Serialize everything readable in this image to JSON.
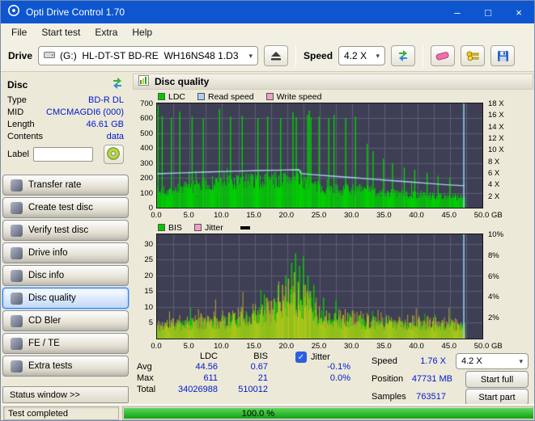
{
  "window": {
    "title": "Opti Drive Control 1.70",
    "controls": {
      "minimize": "–",
      "maximize": "□",
      "close": "×"
    }
  },
  "menu": [
    "File",
    "Start test",
    "Extra",
    "Help"
  ],
  "toolbar": {
    "drive_label": "Drive",
    "drive_value": "(G:)  HL-DT-ST BD-RE  WH16NS48 1.D3",
    "speed_label": "Speed",
    "speed_value": "4.2 X"
  },
  "sidebar": {
    "header": "Disc",
    "info": [
      {
        "label": "Type",
        "value": "BD-R DL"
      },
      {
        "label": "MID",
        "value": "CMCMAGDI6 (000)"
      },
      {
        "label": "Length",
        "value": "46.61 GB"
      },
      {
        "label": "Contents",
        "value": "data"
      }
    ],
    "label_field": {
      "label": "Label",
      "value": ""
    },
    "nav": [
      "Transfer rate",
      "Create test disc",
      "Verify test disc",
      "Drive info",
      "Disc info",
      "Disc quality",
      "CD Bler",
      "FE / TE",
      "Extra tests"
    ],
    "active_nav": "Disc quality",
    "status_window": "Status window >>"
  },
  "main": {
    "title": "Disc quality"
  },
  "stats": {
    "col_ldc": "LDC",
    "col_bis": "BIS",
    "rows": [
      {
        "label": "Avg",
        "ldc": "44.56",
        "bis": "0.67"
      },
      {
        "label": "Max",
        "ldc": "611",
        "bis": "21"
      },
      {
        "label": "Total",
        "ldc": "34026988",
        "bis": "510012"
      }
    ],
    "jitter": {
      "label": "Jitter",
      "checked": true,
      "check_glyph": "✓",
      "avg": "-0.1%",
      "max": "0.0%"
    },
    "speed": {
      "label": "Speed",
      "value": "1.76 X",
      "select": "4.2 X"
    },
    "position": {
      "label": "Position",
      "value": "47731 MB"
    },
    "samples": {
      "label": "Samples",
      "value": "763517"
    },
    "start_full": "Start full",
    "start_part": "Start part"
  },
  "statusbar": {
    "text": "Test completed",
    "progress": "100.0 %"
  },
  "colors": {
    "titlebar_blue": "#0d56d0",
    "value_blue": "#0018cc",
    "chart_bg": "#3e3e54",
    "ldc_green": "#00c800",
    "read_speed_blue": "#a8d0f0",
    "write_speed_pink": "#f0a0c8",
    "jitter_yellow": "#d2c422",
    "progress_green": "#2db82d"
  },
  "chart_data": [
    {
      "name": "ldc",
      "type": "area",
      "title": "Disc quality - LDC / Read speed / Write speed",
      "legend": [
        {
          "label": "LDC",
          "color": "#00c800"
        },
        {
          "label": "Read speed",
          "color": "#a8d0f0"
        },
        {
          "label": "Write speed",
          "color": "#f0a0c8"
        }
      ],
      "marker_dash": false,
      "bg": "#3e3e54",
      "grid": "#5d5d79",
      "xmax": 50,
      "ymax": 700,
      "data_end": 47.3,
      "xgrid": 2.5,
      "cursor": {
        "x": 47.15,
        "color": "#8ad4ee"
      },
      "hlines": [
        0.1429,
        0.2857,
        0.4286,
        0.5714,
        0.7143,
        0.8571
      ],
      "ticks_left": [
        {
          "t": "700",
          "f": 0
        },
        {
          "t": "600",
          "f": 0.1429
        },
        {
          "t": "500",
          "f": 0.2857
        },
        {
          "t": "400",
          "f": 0.4286
        },
        {
          "t": "300",
          "f": 0.5714
        },
        {
          "t": "200",
          "f": 0.7143
        },
        {
          "t": "100",
          "f": 0.8571
        },
        {
          "t": "0",
          "f": 1
        }
      ],
      "ticks_right": [
        {
          "t": "18 X",
          "f": 0
        },
        {
          "t": "16 X",
          "f": 0.111
        },
        {
          "t": "14 X",
          "f": 0.222
        },
        {
          "t": "12 X",
          "f": 0.333
        },
        {
          "t": "10 X",
          "f": 0.444
        },
        {
          "t": "8 X",
          "f": 0.556
        },
        {
          "t": "6 X",
          "f": 0.667
        },
        {
          "t": "4 X",
          "f": 0.778
        },
        {
          "t": "2 X",
          "f": 0.889
        }
      ],
      "ticks_x": [
        {
          "t": "0.0",
          "f": 0
        },
        {
          "t": "5.0",
          "f": 0.1
        },
        {
          "t": "10.0",
          "f": 0.2
        },
        {
          "t": "15.0",
          "f": 0.3
        },
        {
          "t": "20.0",
          "f": 0.4
        },
        {
          "t": "25.0",
          "f": 0.5
        },
        {
          "t": "30.0",
          "f": 0.6
        },
        {
          "t": "35.0",
          "f": 0.7
        },
        {
          "t": "40.0",
          "f": 0.8
        },
        {
          "t": "45.0",
          "f": 0.9
        },
        {
          "t": "50.0",
          "f": 1
        }
      ],
      "x_unit": "GB",
      "series": [
        {
          "name": "LDC",
          "color": "#00d400",
          "seed": 7,
          "step": 0.12,
          "base": 0.55,
          "var": 0.55,
          "min": 10,
          "envelope": [
            [
              0,
              125
            ],
            [
              3,
              150
            ],
            [
              6,
              175
            ],
            [
              10,
              205
            ],
            [
              14,
              215
            ],
            [
              18,
              228
            ],
            [
              21.5,
              238
            ],
            [
              23,
              225
            ],
            [
              24,
              185
            ],
            [
              25,
              155
            ],
            [
              28,
              150
            ],
            [
              31,
              148
            ],
            [
              34,
              128
            ],
            [
              38,
              112
            ],
            [
              42,
              100
            ],
            [
              45,
              90
            ],
            [
              47.3,
              84
            ]
          ],
          "spikes": [
            [
              0.15,
              688
            ],
            [
              0.8,
              615
            ],
            [
              2.2,
              605
            ],
            [
              3.5,
              645
            ],
            [
              5.4,
              612
            ],
            [
              7.1,
              598
            ],
            [
              9.6,
              662
            ],
            [
              11.3,
              612
            ],
            [
              13.1,
              618
            ],
            [
              15.5,
              602
            ],
            [
              17,
              612
            ],
            [
              19,
              602
            ],
            [
              20.9,
              642
            ],
            [
              21.4,
              608
            ],
            [
              23.15,
              622
            ],
            [
              23.4,
              652
            ],
            [
              23.65,
              608
            ],
            [
              24.9,
              612
            ],
            [
              26.4,
              602
            ],
            [
              27.2,
              622
            ],
            [
              29,
              602
            ],
            [
              30.5,
              612
            ],
            [
              32.3,
              430
            ],
            [
              33.2,
              380
            ],
            [
              34.8,
              330
            ],
            [
              36.2,
              300
            ],
            [
              38,
              270
            ],
            [
              39.6,
              255
            ],
            [
              41.5,
              235
            ],
            [
              43.2,
              215
            ],
            [
              45,
              200
            ]
          ]
        }
      ],
      "lines": [
        {
          "name": "Read speed",
          "color": "#a8d0f0",
          "width": 1.4,
          "points": [
            [
              0,
              228
            ],
            [
              4,
              234
            ],
            [
              8,
              240
            ],
            [
              12,
              245
            ],
            [
              16,
              250
            ],
            [
              20,
              253
            ],
            [
              21.8,
              255
            ],
            [
              22.1,
              230
            ],
            [
              24,
              222
            ],
            [
              27,
              212
            ],
            [
              30,
              202
            ],
            [
              33,
              192
            ],
            [
              36,
              182
            ],
            [
              39,
              172
            ],
            [
              42,
              162
            ],
            [
              44.5,
              154
            ],
            [
              47.3,
              147
            ]
          ]
        }
      ]
    },
    {
      "name": "bis",
      "type": "area",
      "title": "Disc quality - BIS / Jitter",
      "legend": [
        {
          "label": "BIS",
          "color": "#00c800"
        },
        {
          "label": "Jitter",
          "color": "#f0a0c8"
        }
      ],
      "marker_dash": true,
      "bg": "#3e3e54",
      "grid": "#5d5d79",
      "xmax": 50,
      "ymax": 33,
      "data_end": 47.3,
      "xgrid": 2.5,
      "cursor": {
        "x": 47.15,
        "color": "#8ad4ee"
      },
      "hlines": [
        0.0909,
        0.2424,
        0.3939,
        0.5455,
        0.697,
        0.8485
      ],
      "ticks_left": [
        {
          "t": "30",
          "f": 0.0909
        },
        {
          "t": "25",
          "f": 0.2424
        },
        {
          "t": "20",
          "f": 0.3939
        },
        {
          "t": "15",
          "f": 0.5455
        },
        {
          "t": "10",
          "f": 0.697
        },
        {
          "t": "5",
          "f": 0.8485
        }
      ],
      "ticks_right": [
        {
          "t": "10%",
          "f": 0
        },
        {
          "t": "8%",
          "f": 0.2
        },
        {
          "t": "6%",
          "f": 0.4
        },
        {
          "t": "4%",
          "f": 0.6
        },
        {
          "t": "2%",
          "f": 0.8
        }
      ],
      "ticks_x": [
        {
          "t": "0.0",
          "f": 0
        },
        {
          "t": "5.0",
          "f": 0.1
        },
        {
          "t": "10.0",
          "f": 0.2
        },
        {
          "t": "15.0",
          "f": 0.3
        },
        {
          "t": "20.0",
          "f": 0.4
        },
        {
          "t": "25.0",
          "f": 0.5
        },
        {
          "t": "30.0",
          "f": 0.6
        },
        {
          "t": "35.0",
          "f": 0.7
        },
        {
          "t": "40.0",
          "f": 0.8
        },
        {
          "t": "45.0",
          "f": 0.9
        },
        {
          "t": "50.0",
          "f": 1
        }
      ],
      "x_unit": "GB",
      "series": [
        {
          "name": "BIS",
          "color": "#00d400",
          "seed": 3,
          "step": 0.12,
          "base": 0.45,
          "var": 0.95,
          "min": 1.2,
          "envelope": [
            [
              0,
              3.5
            ],
            [
              4,
              4.5
            ],
            [
              8,
              5
            ],
            [
              12,
              6
            ],
            [
              15,
              7
            ],
            [
              17,
              8.5
            ],
            [
              19,
              10
            ],
            [
              21,
              13
            ],
            [
              22.5,
              13
            ],
            [
              24,
              10
            ],
            [
              25,
              6.5
            ],
            [
              28,
              6
            ],
            [
              31,
              5.5
            ],
            [
              35,
              5
            ],
            [
              39,
              4.5
            ],
            [
              43,
              4
            ],
            [
              47.3,
              3.5
            ]
          ],
          "spikes": [
            [
              16.5,
              14
            ],
            [
              18.6,
              17
            ],
            [
              19.8,
              20
            ],
            [
              20.7,
              24
            ],
            [
              21.3,
              27
            ],
            [
              21.9,
              23
            ],
            [
              22.5,
              26
            ],
            [
              23.2,
              20
            ],
            [
              24.1,
              17
            ],
            [
              25.6,
              13
            ],
            [
              27.5,
              12
            ]
          ]
        },
        {
          "name": "Jitter",
          "color": "#d2c422",
          "seed": 11,
          "step": 0.12,
          "base": 0.45,
          "var": 0.95,
          "min": 1.5,
          "alpha": 0.8,
          "envelope": [
            [
              0,
              4.5
            ],
            [
              4,
              5.5
            ],
            [
              8,
              6
            ],
            [
              12,
              7
            ],
            [
              15,
              8
            ],
            [
              17,
              10
            ],
            [
              19,
              12
            ],
            [
              21,
              14
            ],
            [
              22.5,
              13
            ],
            [
              24,
              11
            ],
            [
              25,
              8
            ],
            [
              28,
              7
            ],
            [
              31,
              6.5
            ],
            [
              35,
              6
            ],
            [
              39,
              5.5
            ],
            [
              43,
              5
            ],
            [
              47.3,
              4.5
            ]
          ],
          "spikes": [
            [
              19.3,
              17
            ],
            [
              20.2,
              19
            ],
            [
              21.1,
              21
            ],
            [
              21.7,
              18
            ],
            [
              22.8,
              17
            ],
            [
              23.5,
              15
            ]
          ]
        }
      ],
      "lines": []
    }
  ]
}
